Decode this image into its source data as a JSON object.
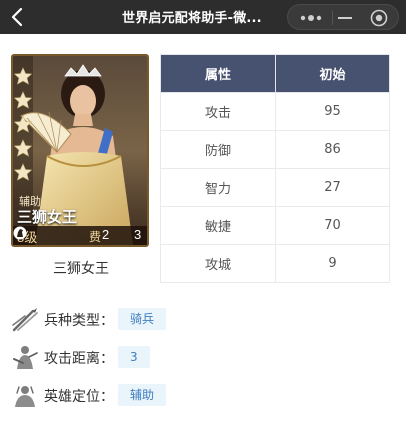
{
  "nav": {
    "title": "世界启元配将助手-微...",
    "icons": [
      "back-icon",
      "more-icon",
      "minimize-icon",
      "close-target-icon"
    ]
  },
  "hero": {
    "role": "辅助",
    "name": "三狮女王",
    "level": "8级",
    "cost_label": "费",
    "cost": "2",
    "unit_value": "3",
    "stars": 5,
    "caption": "三狮女王"
  },
  "stats": {
    "headers": [
      "属性",
      "初始"
    ],
    "rows": [
      {
        "name": "攻击",
        "value": "95"
      },
      {
        "name": "防御",
        "value": "86"
      },
      {
        "name": "智力",
        "value": "27"
      },
      {
        "name": "敏捷",
        "value": "70"
      },
      {
        "name": "攻城",
        "value": "9"
      }
    ]
  },
  "info": [
    {
      "label": "兵种类型：",
      "value": "骑兵",
      "icon": "troop-type-icon"
    },
    {
      "label": "攻击距离：",
      "value": "3",
      "icon": "attack-range-icon"
    },
    {
      "label": "英雄定位：",
      "value": "辅助",
      "icon": "hero-role-icon"
    }
  ]
}
